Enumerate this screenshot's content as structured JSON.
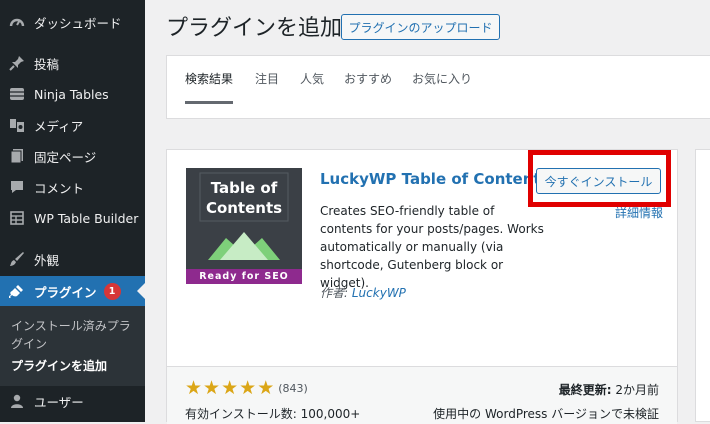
{
  "sidebar": {
    "items": [
      {
        "label": "ダッシュボード",
        "icon": "dashboard-icon"
      },
      {
        "label": "投稿",
        "icon": "pin-icon"
      },
      {
        "label": "Ninja Tables",
        "icon": "table-icon"
      },
      {
        "label": "メディア",
        "icon": "media-icon"
      },
      {
        "label": "固定ページ",
        "icon": "page-icon"
      },
      {
        "label": "コメント",
        "icon": "comment-icon"
      },
      {
        "label": "WP Table Builder",
        "icon": "grid-icon"
      },
      {
        "label": "外観",
        "icon": "brush-icon"
      },
      {
        "label": "プラグイン",
        "icon": "plugin-icon",
        "badge": "1"
      },
      {
        "label": "ユーザー",
        "icon": "user-icon"
      }
    ],
    "submenu": [
      {
        "label": "インストール済みプラグイン"
      },
      {
        "label": "プラグインを追加"
      }
    ]
  },
  "header": {
    "title": "プラグインを追加",
    "upload_label": "プラグインのアップロード"
  },
  "tabs": [
    {
      "label": "検索結果"
    },
    {
      "label": "注目"
    },
    {
      "label": "人気"
    },
    {
      "label": "おすすめ"
    },
    {
      "label": "お気に入り"
    }
  ],
  "plugin": {
    "thumb_title": "Table of\nContents",
    "thumb_ready": "Ready for SEO",
    "name": "LuckyWP Table of Contents",
    "install_label": "今すぐインストール",
    "details_label": "詳細情報",
    "description": "Creates SEO-friendly table of contents for your posts/pages. Works automatically or manually (via shortcode, Gutenberg block or widget).",
    "author_prefix": "作者:",
    "author": "LuckyWP",
    "rating_count": "(843)",
    "installs": "有効インストール数: 100,000+",
    "last_updated_label": "最終更新:",
    "last_updated_value": "2か月前",
    "compat": "使用中の WordPress バージョンで未検証"
  },
  "colors": {
    "sidebar_bg": "#1d2327",
    "accent": "#2271b1",
    "highlight": "#e00000",
    "star": "#dba617",
    "badge": "#d63638"
  }
}
